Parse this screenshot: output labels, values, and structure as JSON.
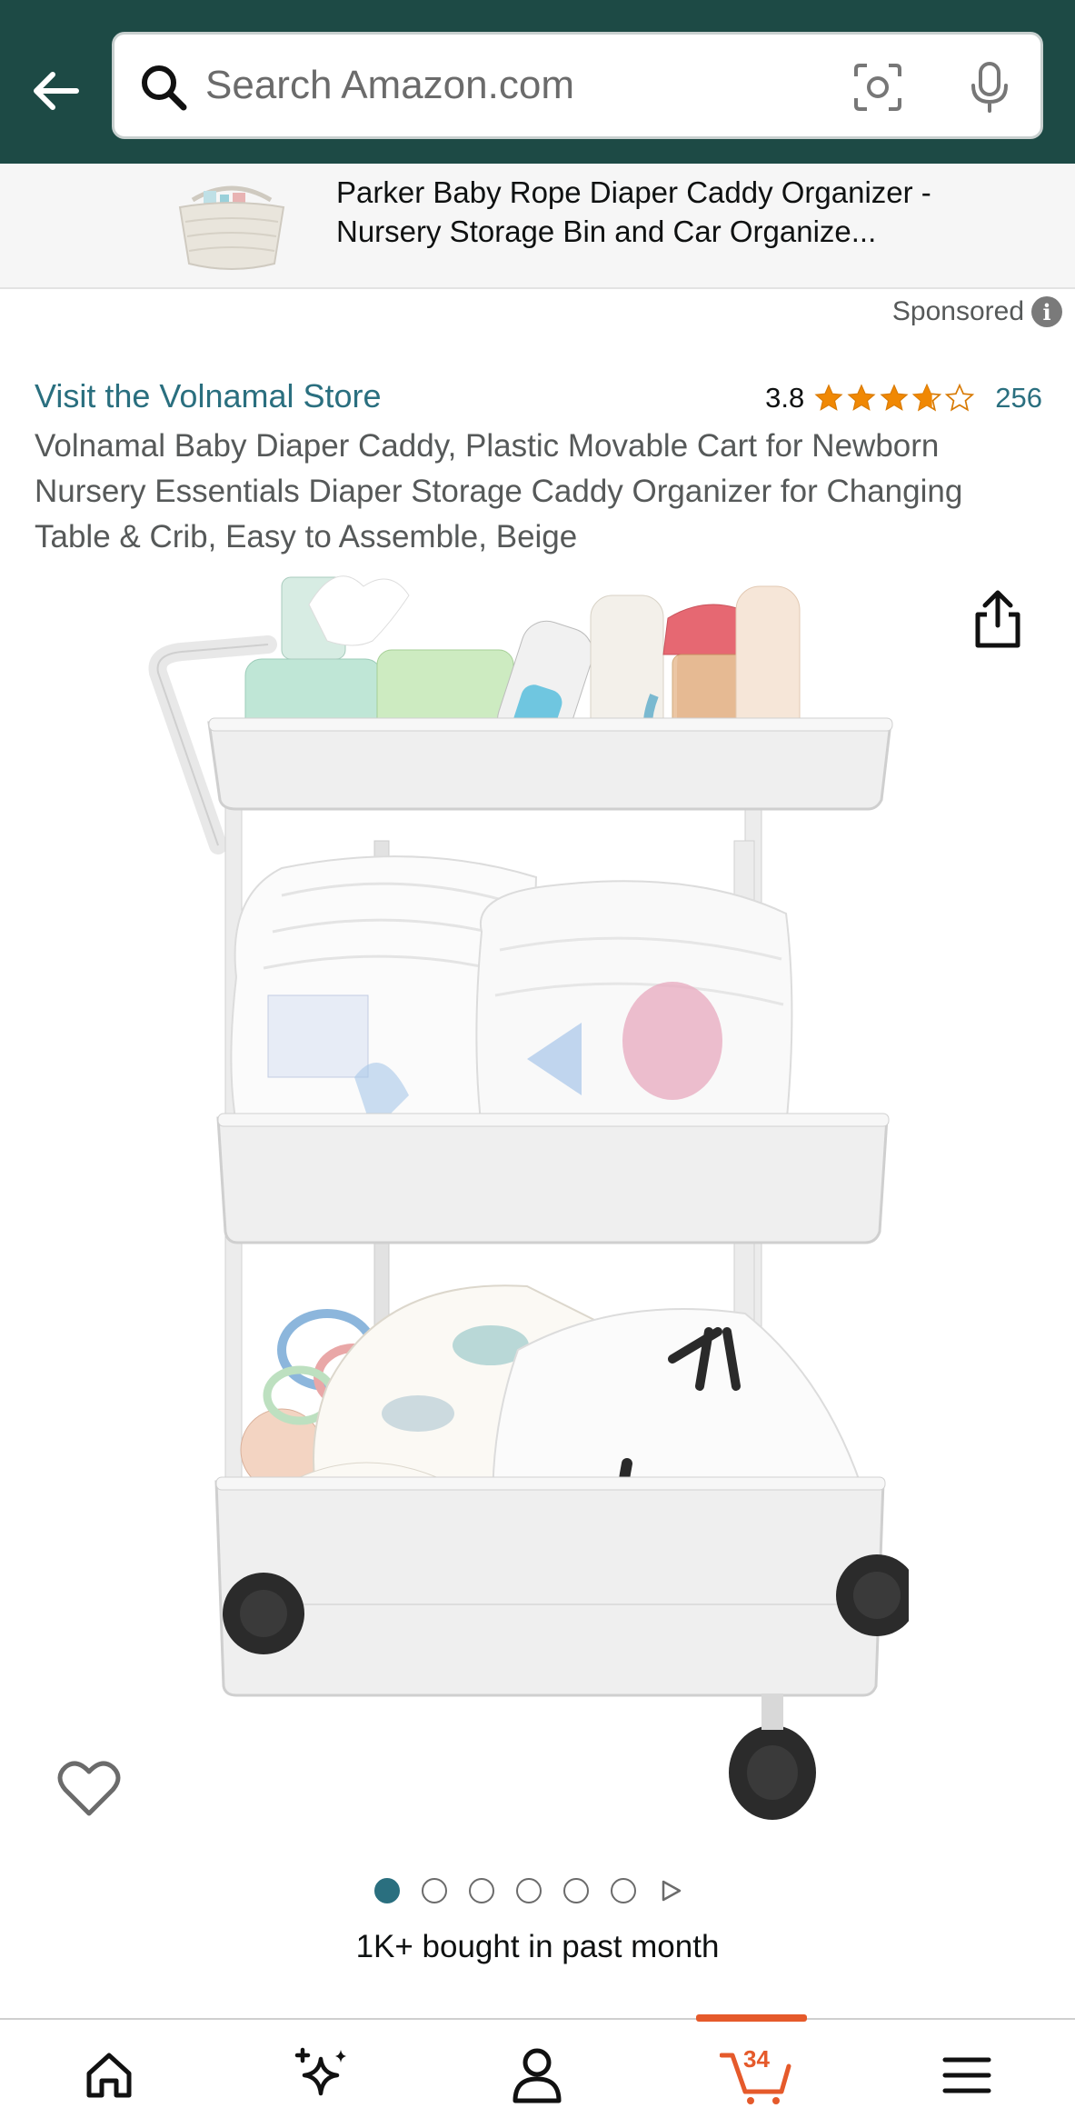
{
  "header": {
    "search_placeholder": "Search Amazon.com"
  },
  "ad_banner": {
    "text": "Parker Baby Rope Diaper Caddy Organizer - Nursery Storage Bin and Car Organize..."
  },
  "sponsored_label": "Sponsored",
  "product": {
    "store_link": "Visit the Volnamal Store",
    "rating": "3.8",
    "rating_count": "256",
    "title": "Volnamal Baby Diaper Caddy, Plastic Movable Cart for Newborn Nursery Essentials Diaper Storage Caddy Organizer for Changing Table & Crib, Easy to Assemble, Beige",
    "bought_text": "1K+ bought in past month"
  },
  "gallery": {
    "image_count": 6,
    "active_index": 0
  },
  "bottom_nav": {
    "cart_count": "34"
  },
  "colors": {
    "header_bg": "#1d4a45",
    "link": "#2a6f7f",
    "star": "#f08804",
    "cart_accent": "#e55a2b"
  }
}
